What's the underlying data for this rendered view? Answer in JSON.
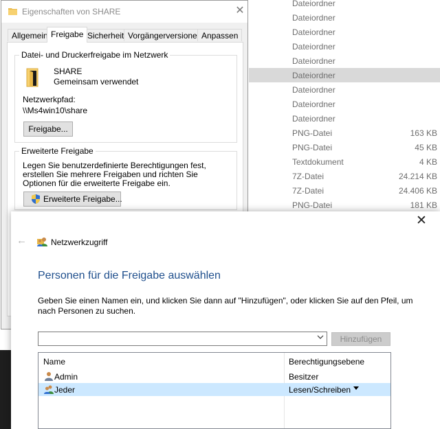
{
  "explorer": {
    "rows": [
      {
        "type": "Dateiordner",
        "size": ""
      },
      {
        "type": "Dateiordner",
        "size": ""
      },
      {
        "type": "Dateiordner",
        "size": ""
      },
      {
        "type": "Dateiordner",
        "size": ""
      },
      {
        "type": "Dateiordner",
        "size": ""
      },
      {
        "type": "Dateiordner",
        "size": ""
      },
      {
        "type": "Dateiordner",
        "size": ""
      },
      {
        "type": "Dateiordner",
        "size": ""
      },
      {
        "type": "Dateiordner",
        "size": ""
      },
      {
        "type": "PNG-Datei",
        "size": "163 KB"
      },
      {
        "type": "PNG-Datei",
        "size": "45 KB"
      },
      {
        "type": "Textdokument",
        "size": "4 KB"
      },
      {
        "type": "7Z-Datei",
        "size": "24.214 KB"
      },
      {
        "type": "7Z-Datei",
        "size": "24.406 KB"
      },
      {
        "type": "PNG-Datei",
        "size": "181 KB"
      }
    ],
    "selected_index": 5,
    "partial_sizes": [
      "KB",
      "KB",
      "KB",
      "KB"
    ]
  },
  "properties": {
    "title": "Eigenschaften von SHARE",
    "tabs": [
      "Allgemein",
      "Freigabe",
      "Sicherheit",
      "Vorgängerversionen",
      "Anpassen"
    ],
    "active_tab": "Freigabe",
    "network_share_group": "Datei- und Druckerfreigabe im Netzwerk",
    "share_name": "SHARE",
    "share_status": "Gemeinsam verwendet",
    "network_path_label": "Netzwerkpfad:",
    "network_path": "\\\\Ms4win10\\share",
    "share_button": "Freigabe...",
    "advanced_group": "Erweiterte Freigabe",
    "advanced_text": "Legen Sie benutzerdefinierte Berechtigungen fest, erstellen Sie mehrere Freigaben und richten Sie Optionen für die erweiterte Freigabe ein.",
    "advanced_button": "Erweiterte Freigabe..."
  },
  "dialog": {
    "title": "Netzwerkzugriff",
    "heading": "Personen für die Freigabe auswählen",
    "instructions": "Geben Sie einen Namen ein, und klicken Sie dann auf \"Hinzufügen\", oder klicken Sie auf den Pfeil, um nach Personen zu suchen.",
    "name_input_value": "",
    "add_button": "Hinzufügen",
    "columns": [
      "Name",
      "Berechtigungsebene"
    ],
    "users": [
      {
        "name": "Admin",
        "permission": "Besitzer",
        "selected": false
      },
      {
        "name": "Jeder",
        "permission": "Lesen/Schreiben",
        "selected": true
      }
    ]
  },
  "colors": {
    "heading": "#1e4e8c",
    "selected_row": "#cce8ff",
    "explorer_selected": "#d9d9d9"
  }
}
